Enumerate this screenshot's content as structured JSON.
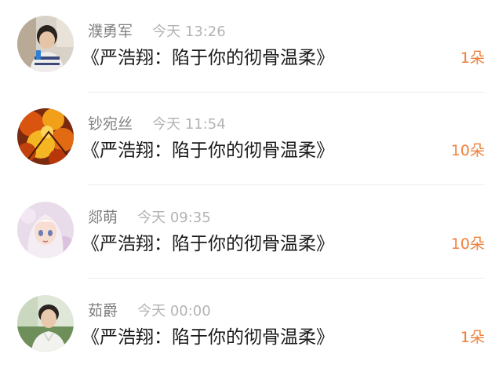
{
  "items": [
    {
      "avatar_icon": "user-avatar-boy-with-phone",
      "name": "濮勇军",
      "time": "今天 13:26",
      "title": "《严浩翔：陷于你的彻骨温柔》",
      "count": "1朵"
    },
    {
      "avatar_icon": "user-avatar-autumn-leaves",
      "name": "钞宛丝",
      "time": "今天 11:54",
      "title": "《严浩翔：陷于你的彻骨温柔》",
      "count": "10朵"
    },
    {
      "avatar_icon": "user-avatar-anime-girl",
      "name": "郯萌",
      "time": "今天 09:35",
      "title": "《严浩翔：陷于你的彻骨温柔》",
      "count": "10朵"
    },
    {
      "avatar_icon": "user-avatar-young-man",
      "name": "茹爵",
      "time": "今天 00:00",
      "title": "《严浩翔：陷于你的彻骨温柔》",
      "count": "1朵"
    }
  ],
  "colors": {
    "count_accent": "#f07f38",
    "name_gray": "#808080",
    "time_gray": "#b3b3b3",
    "title_text": "#1a1a1a"
  }
}
